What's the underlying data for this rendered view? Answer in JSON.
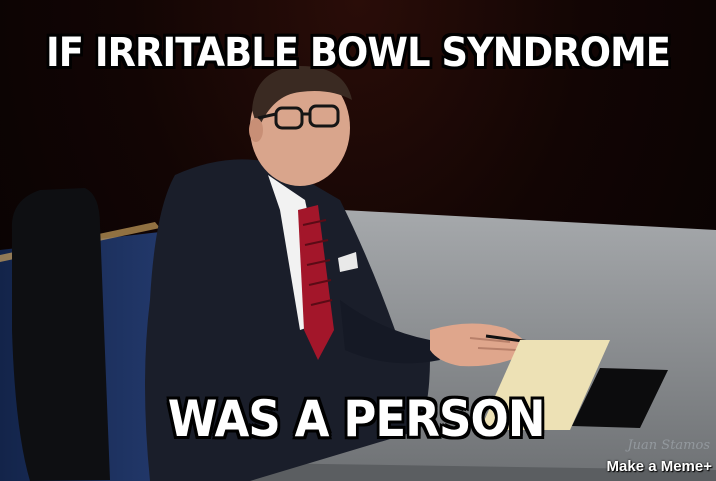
{
  "meme": {
    "top_text": "IF IRRITABLE BOWL SYNDROME",
    "bottom_text": "WAS A PERSON",
    "signature": "Juan Stamos",
    "watermark": "Make a Meme+"
  },
  "colors": {
    "caption": "#ffffff",
    "caption_outline": "#000000",
    "desk": "#8e9194",
    "suit": "#1a1e2a",
    "tie": "#a3162a",
    "floor": "#1b2f57"
  }
}
